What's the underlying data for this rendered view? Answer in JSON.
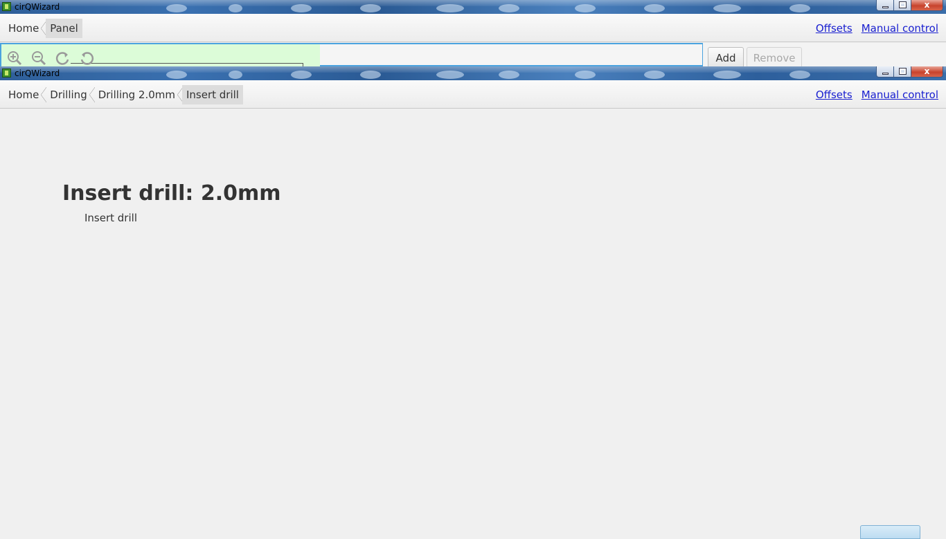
{
  "back_window": {
    "title": "cirQWizard",
    "close_glyph": "x",
    "breadcrumbs": [
      {
        "label": "Home"
      },
      {
        "label": "Panel"
      }
    ],
    "links": {
      "offsets": "Offsets",
      "manual_control": "Manual control"
    },
    "toolbar_icons": [
      "zoom-in-icon",
      "zoom-out-icon",
      "rotate-clockwise-icon",
      "rotate-counterclockwise-icon"
    ],
    "buttons": {
      "add": "Add",
      "remove": "Remove"
    },
    "remove_disabled": true
  },
  "front_window": {
    "title": "cirQWizard",
    "close_glyph": "x",
    "breadcrumbs": [
      {
        "label": "Home"
      },
      {
        "label": "Drilling"
      },
      {
        "label": "Drilling 2.0mm"
      },
      {
        "label": "Insert drill"
      }
    ],
    "links": {
      "offsets": "Offsets",
      "manual_control": "Manual control"
    },
    "heading": "Insert drill: 2.0mm",
    "instruction": "Insert drill",
    "colors": {
      "canvas_highlight": "#dcfcd8",
      "link": "#1a20d0",
      "title_bar": "#2f5f99"
    }
  }
}
